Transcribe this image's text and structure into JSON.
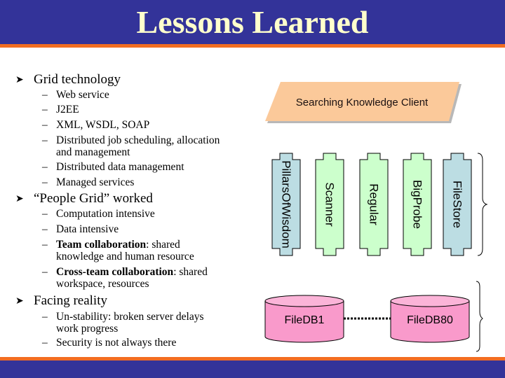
{
  "slide": {
    "title": "Lessons Learned",
    "colors": {
      "header_bg": "#333399",
      "accent_stripe": "#f26d21",
      "title_text": "#ffffcc",
      "client_fill": "#fbc99a",
      "server_green": "#ccffcc",
      "server_blue": "#bcdde3",
      "db_fill": "#f99acb"
    }
  },
  "outline": [
    {
      "heading": "Grid technology",
      "bullet_icon": "arrowhead-bullet",
      "items": [
        {
          "lines": [
            "Web service"
          ]
        },
        {
          "lines": [
            "J2EE"
          ]
        },
        {
          "lines": [
            "XML, WSDL, SOAP"
          ]
        },
        {
          "lines": [
            "Distributed job scheduling, allocation",
            "and management"
          ]
        },
        {
          "lines": [
            "Distributed data management"
          ]
        },
        {
          "lines": [
            "Managed services"
          ]
        }
      ]
    },
    {
      "heading": "“People Grid” worked",
      "bullet_icon": "arrowhead-bullet",
      "items": [
        {
          "lines": [
            "Computation intensive"
          ]
        },
        {
          "lines": [
            "Data intensive"
          ]
        },
        {
          "bold": "Team collaboration",
          "rest": ": shared",
          "lines": [
            "",
            "knowledge and human resource"
          ]
        },
        {
          "bold": "Cross-team collaboration",
          "rest": ": shared",
          "lines": [
            "",
            "workspace, resources"
          ]
        }
      ]
    },
    {
      "heading": "Facing reality",
      "bullet_icon": "arrowhead-bullet",
      "items": [
        {
          "lines": [
            "Un-stability: broken server delays",
            "work progress"
          ]
        },
        {
          "lines": [
            "Security is not always there"
          ]
        }
      ]
    }
  ],
  "dash": "–",
  "diagram": {
    "client": {
      "label": "Searching Knowledge Client"
    },
    "servers": [
      {
        "label": "PillarsOfWisdom",
        "color": "blue"
      },
      {
        "label": "Scanner",
        "color": "green"
      },
      {
        "label": "Regular",
        "color": "green"
      },
      {
        "label": "BigProbe",
        "color": "green"
      },
      {
        "label": "FileStore",
        "color": "blue"
      }
    ],
    "databases": [
      {
        "label": "FileDB1"
      },
      {
        "label": "FileDB80"
      }
    ],
    "db_link": "dotted-connector",
    "braces": [
      "server-group-brace",
      "database-group-brace"
    ]
  }
}
